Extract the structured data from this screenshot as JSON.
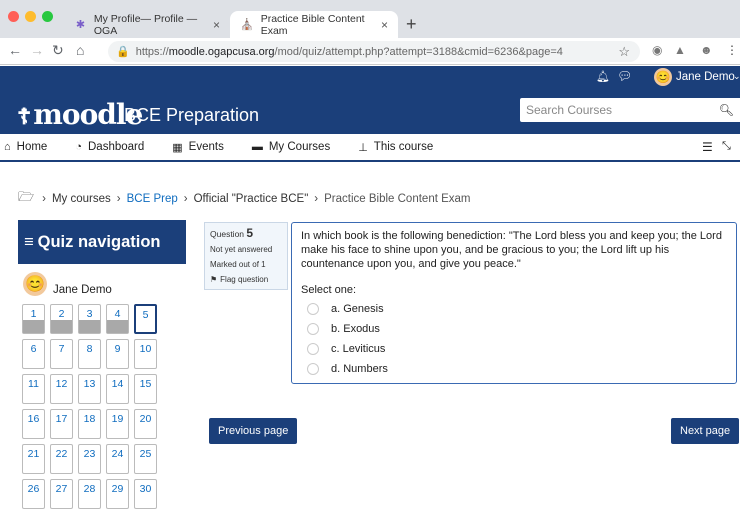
{
  "browser": {
    "tabs": [
      {
        "title": "My Profile— Profile — OGA"
      },
      {
        "title": "Practice Bible Content Exam"
      }
    ],
    "url_prefix": "https://",
    "url_host": "moodle.ogapcusa.org",
    "url_path": "/mod/quiz/attempt.php?attempt=3188&cmid=6236&page=4"
  },
  "topbar": {
    "user_name": "Jane Demo"
  },
  "brand": {
    "logo": "moodle",
    "site_title": "BCE Preparation",
    "search_placeholder": "Search Courses"
  },
  "nav": {
    "items": [
      {
        "label": "Home",
        "icon": "home-icon"
      },
      {
        "label": "Dashboard",
        "icon": "dashboard-icon"
      },
      {
        "label": "Events",
        "icon": "calendar-icon"
      },
      {
        "label": "My Courses",
        "icon": "courses-icon"
      },
      {
        "label": "This course",
        "icon": "sitemap-icon"
      }
    ]
  },
  "breadcrumb": {
    "items": [
      "My courses",
      "BCE Prep",
      "Official \"Practice BCE\"",
      "Practice Bible Content Exam"
    ]
  },
  "quiz_nav": {
    "title": "Quiz navigation",
    "user": "Jane Demo",
    "numbers": [
      "1",
      "2",
      "3",
      "4",
      "5",
      "6",
      "7",
      "8",
      "9",
      "10",
      "11",
      "12",
      "13",
      "14",
      "15",
      "16",
      "17",
      "18",
      "19",
      "20",
      "21",
      "22",
      "23",
      "24",
      "25",
      "26",
      "27",
      "28",
      "29",
      "30"
    ],
    "answered": [
      1,
      2,
      3,
      4
    ],
    "current": 5
  },
  "question": {
    "label": "Question",
    "number": "5",
    "state": "Not yet answered",
    "marks": "Marked out of 1",
    "flag": "Flag question",
    "text": "In which book is the following benediction: \"The Lord bless you and keep you; the Lord make his face to shine upon you, and be gracious to you; the Lord lift up his countenance upon you, and give you peace.\"",
    "prompt": "Select one:",
    "options": [
      "a. Genesis",
      "b. Exodus",
      "c. Leviticus",
      "d. Numbers"
    ]
  },
  "buttons": {
    "previous": "Previous page",
    "next": "Next page"
  },
  "colors": {
    "brand": "#1b3f7a",
    "link": "#0f6cbf"
  }
}
